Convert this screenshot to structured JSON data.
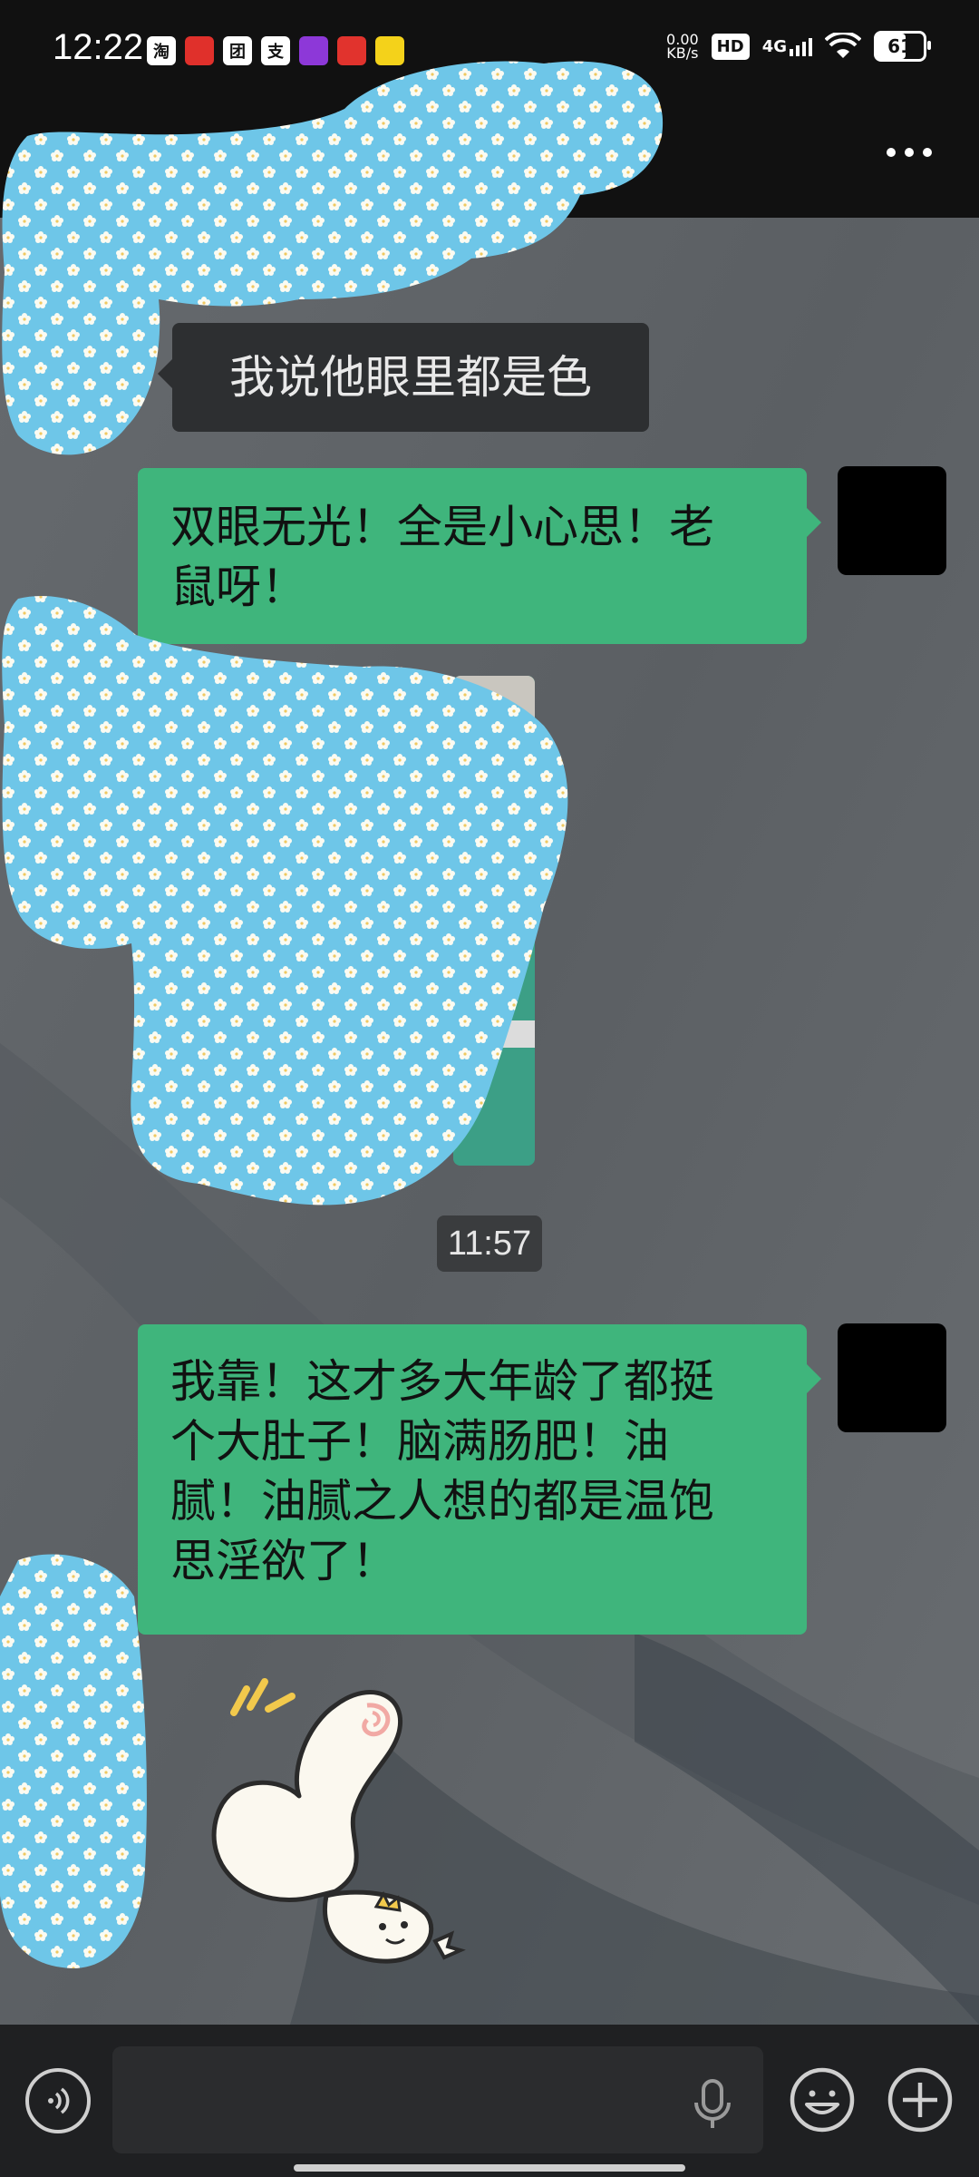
{
  "status_bar": {
    "time": "12:22",
    "net_speed_value": "0.00",
    "net_speed_unit": "KB/s",
    "hd_label": "HD",
    "signal_label": "4G",
    "battery_level": "61",
    "app_icons": [
      {
        "name": "taobao-icon",
        "glyph": "淘",
        "color": "#ffffff"
      },
      {
        "name": "app-red-icon",
        "glyph": "",
        "color": "#e0302b"
      },
      {
        "name": "meituan-icon",
        "glyph": "团",
        "color": "#ffffff"
      },
      {
        "name": "alipay-icon",
        "glyph": "支",
        "color": "#ffffff"
      },
      {
        "name": "app-purple-icon",
        "glyph": "",
        "color": "#8d38d8"
      },
      {
        "name": "app-heart-icon",
        "glyph": "",
        "color": "#e1332d"
      },
      {
        "name": "app-yellow-icon",
        "glyph": "",
        "color": "#f4d21a"
      }
    ]
  },
  "messages": [
    {
      "side": "in",
      "text": "我说他眼里都是色"
    },
    {
      "side": "out",
      "text_lines": [
        "双眼无光！全是小心思！老",
        "鼠呀！"
      ]
    },
    {
      "side": "in",
      "type": "image"
    },
    {
      "type": "timestamp",
      "text": "11:57"
    },
    {
      "side": "out",
      "text_lines": [
        "我靠！这才多大年龄了都挺",
        "个大肚子！脑满肠肥！油",
        "腻！油腻之人想的都是温饱",
        "思淫欲了！"
      ]
    },
    {
      "side": "in",
      "type": "sticker"
    }
  ],
  "colors": {
    "outgoing_bubble": "#3fb57c",
    "incoming_bubble": "#2d2f31",
    "chat_background": "#5e6266",
    "censor_blue": "#6ec6e8"
  },
  "input_bar": {
    "placeholder": ""
  }
}
